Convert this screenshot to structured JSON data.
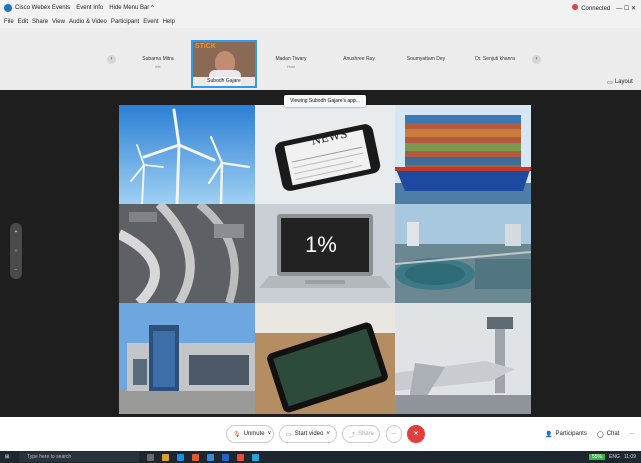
{
  "window": {
    "app_title": "Cisco Webex Events",
    "event_info": "Event Info",
    "hide_menu": "Hide Menu Bar ^",
    "connected": "Connected",
    "win_controls": "—  ☐  ✕"
  },
  "menu": [
    "File",
    "Edit",
    "Share",
    "View",
    "Audio & Video",
    "Participant",
    "Event",
    "Help"
  ],
  "participants": [
    {
      "name": "Subarna Mitra",
      "sub": "Me"
    },
    {
      "name": "Madan Tiwary",
      "sub": "Host"
    },
    {
      "name": "Anushree Ray",
      "sub": ""
    },
    {
      "name": "Soumyattam Dey",
      "sub": ""
    },
    {
      "name": "Dr. Senjuti khanra",
      "sub": ""
    }
  ],
  "active_speaker": {
    "name": "Subodh Gajare",
    "logo_text": "STiCK"
  },
  "layout_label": "Layout",
  "viewing_banner": "Viewing Subodh Gajare's app...",
  "shared_content": {
    "center_value": "1%",
    "news_word": "NEWS",
    "tiles": [
      "wind-turbines",
      "news-phone",
      "cargo-ship",
      "conveyor-factory",
      "laptop-1-percent",
      "water-treatment",
      "retail-building",
      "tablet",
      "airport-tower"
    ]
  },
  "controls": {
    "unmute": "Unmute",
    "start_video": "Start video",
    "share": "Share",
    "more": "···",
    "participants": "Participants",
    "chat": "Chat",
    "overflow": "···"
  },
  "taskbar": {
    "search_placeholder": "Type here to search",
    "battery": "55%",
    "lang": "ENG",
    "time": "11:09"
  },
  "colors": {
    "accent": "#2e9be6",
    "end_call": "#e43b3b",
    "connected": "#e64040"
  }
}
